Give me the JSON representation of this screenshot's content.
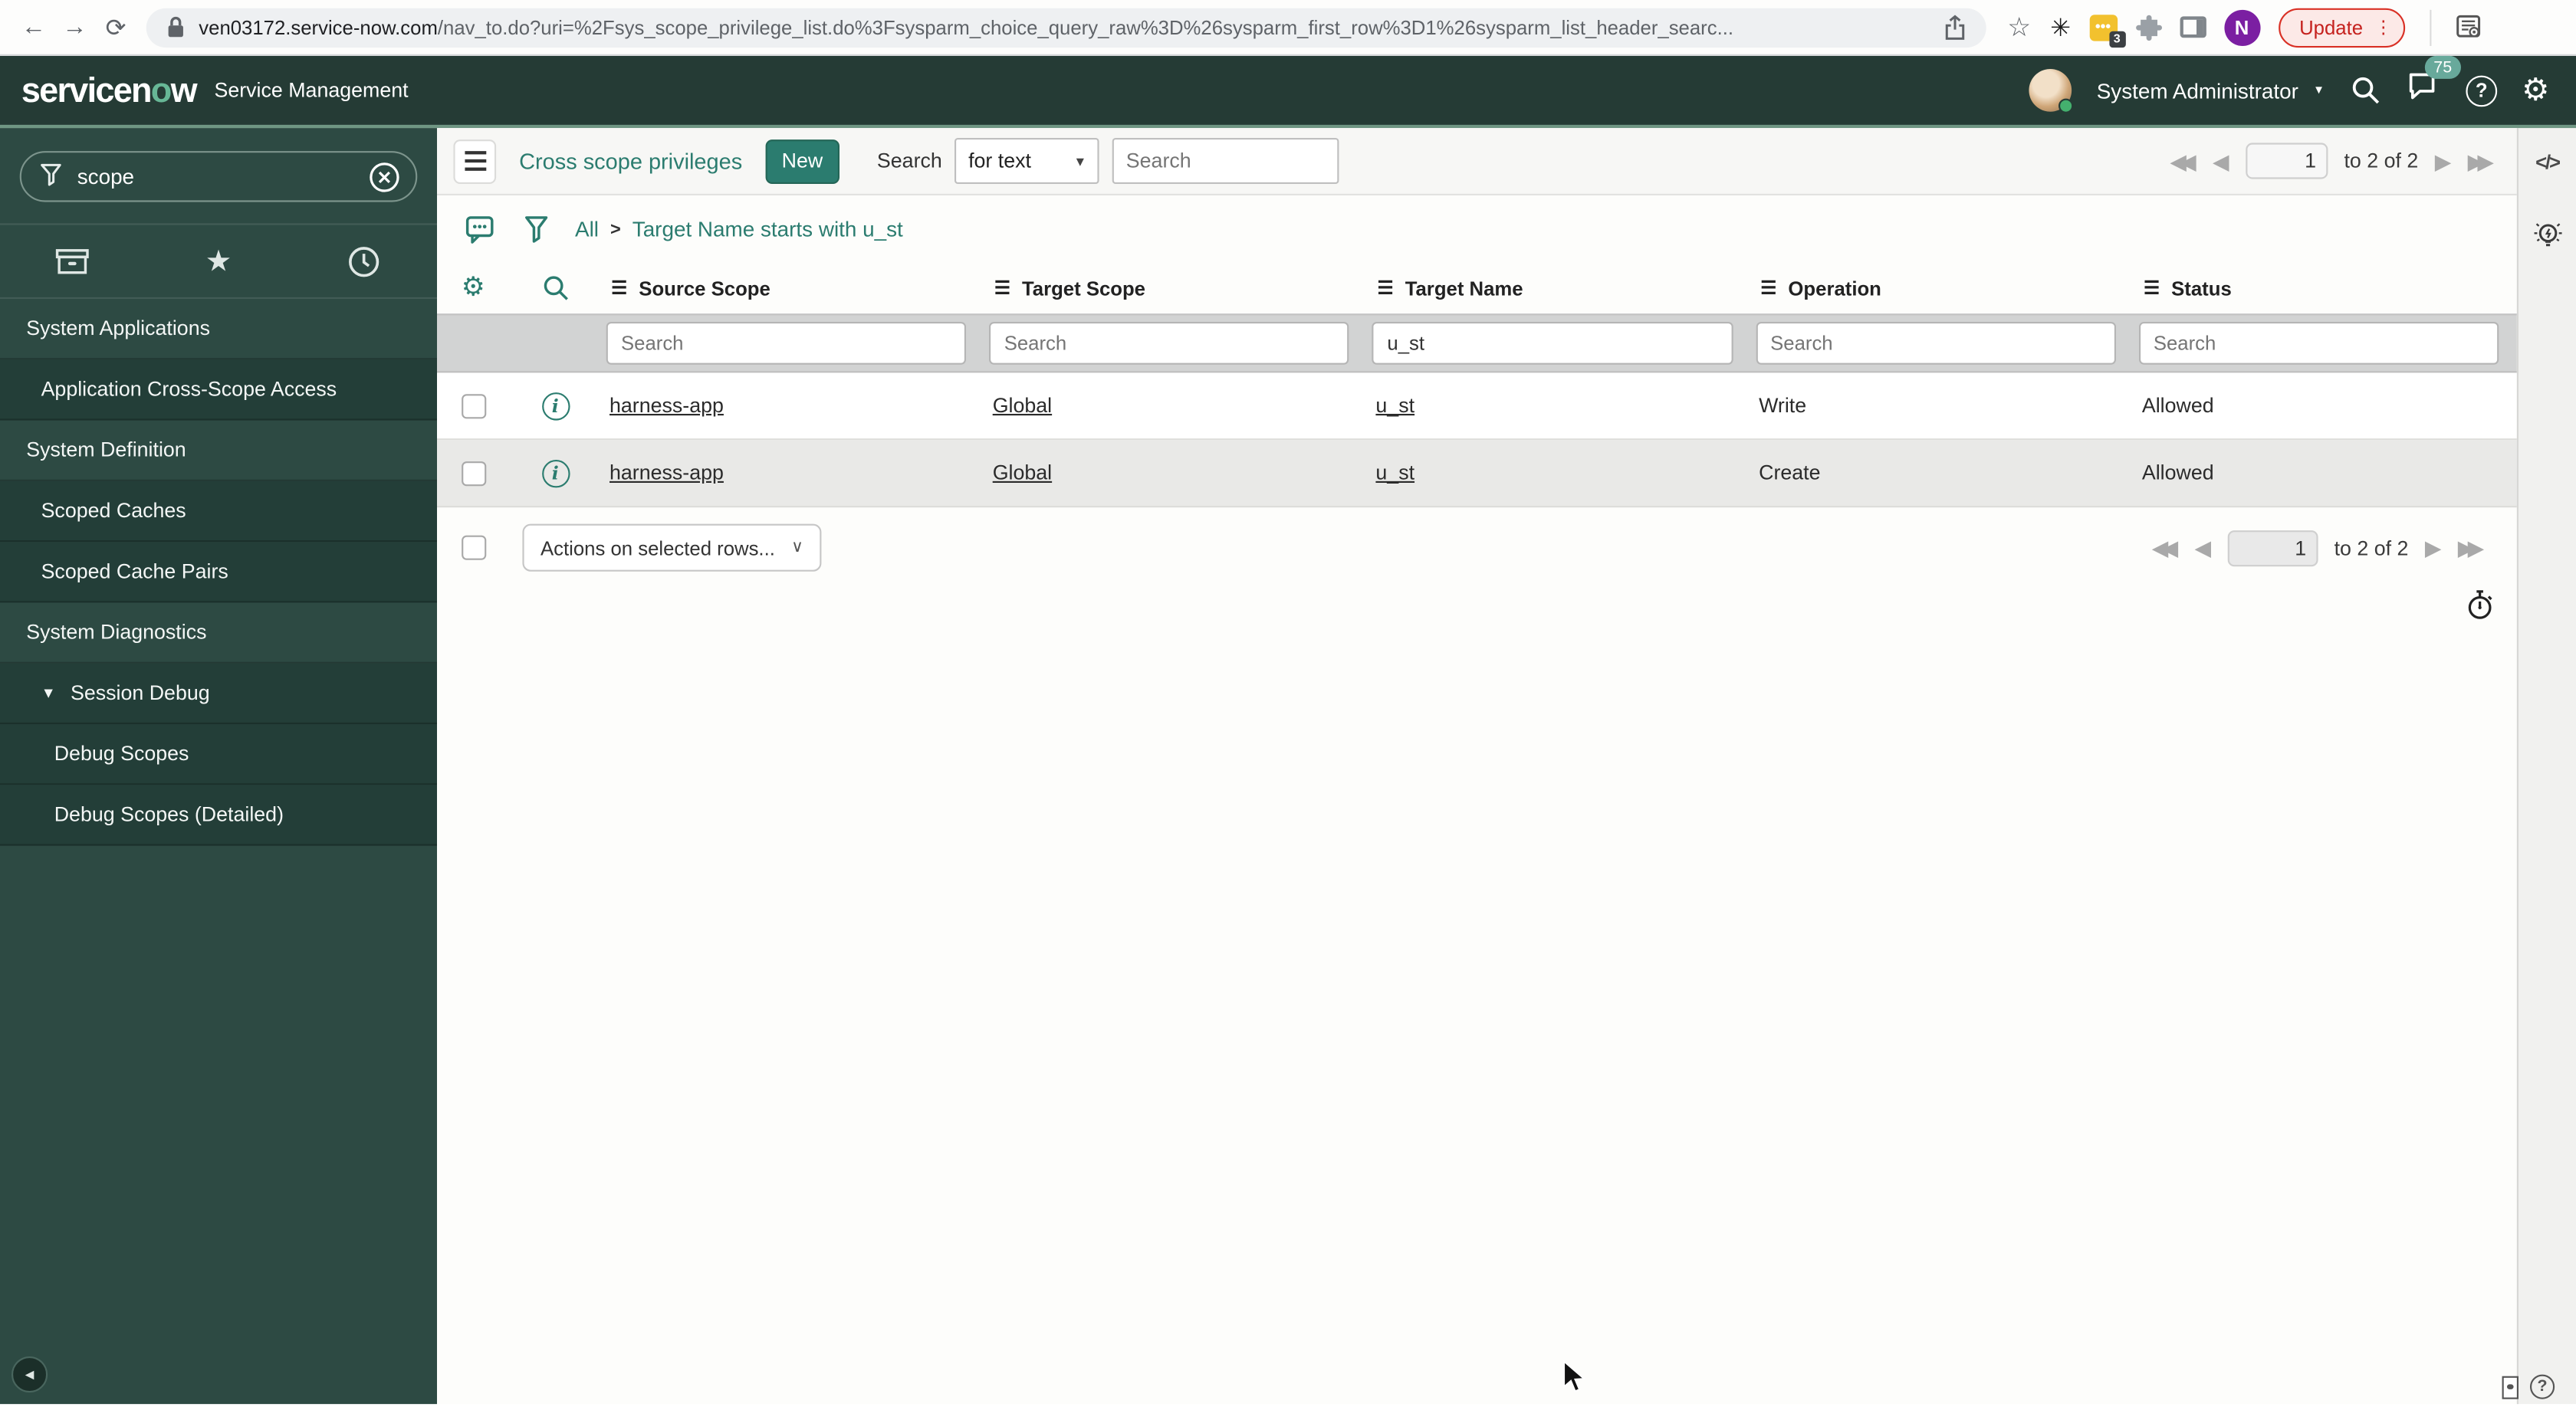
{
  "browser": {
    "url_domain": "ven03172.service-now.com",
    "url_path": "/nav_to.do?uri=%2Fsys_scope_privilege_list.do%3Fsysparm_choice_query_raw%3D%26sysparm_first_row%3D1%26sysparm_list_header_searc...",
    "update_label": "Update",
    "update_dots": "⋮",
    "profile_initial": "N",
    "extension_badge": "3",
    "extension_dots": "•••",
    "icons": {
      "back": "←",
      "forward": "→",
      "reload": "⟳",
      "bookmark": "☆",
      "spinner": "✳"
    }
  },
  "banner": {
    "logo_prefix": "servicen",
    "logo_o": "o",
    "logo_suffix": "w",
    "product": "Service Management",
    "user_name": "System Administrator",
    "user_caret": "▼",
    "notification_count": "75",
    "help_glyph": "?",
    "gear_glyph": "⚙"
  },
  "sidebar": {
    "search_value": "scope",
    "favorites_glyph": "★",
    "collapse_glyph": "◄",
    "items": [
      {
        "label": "System Applications",
        "type": "section"
      },
      {
        "label": "Application Cross-Scope Access",
        "type": "child"
      },
      {
        "label": "System Definition",
        "type": "section"
      },
      {
        "label": "Scoped Caches",
        "type": "child"
      },
      {
        "label": "Scoped Cache Pairs",
        "type": "child"
      },
      {
        "label": "System Diagnostics",
        "type": "section"
      },
      {
        "label": "Session Debug",
        "type": "child",
        "caret": "▼"
      },
      {
        "label": "Debug Scopes",
        "type": "grandchild"
      },
      {
        "label": "Debug Scopes (Detailed)",
        "type": "grandchild"
      }
    ]
  },
  "list": {
    "title": "Cross scope privileges",
    "new_button": "New",
    "search_label": "Search",
    "search_type": "for text",
    "select_caret": "▼",
    "search_placeholder": "Search",
    "menu_glyph": "☰"
  },
  "breadcrumb": {
    "root": "All",
    "separator": ">",
    "query": "Target Name starts with u_st"
  },
  "pagination": {
    "page": "1",
    "range_label": "to 2 of 2",
    "first": "◀◀",
    "prev": "◀",
    "next": "▶",
    "last": "▶▶"
  },
  "table": {
    "columns": [
      "Source Scope",
      "Target Scope",
      "Target Name",
      "Operation",
      "Status"
    ],
    "filters": [
      {
        "placeholder": "Search",
        "value": ""
      },
      {
        "placeholder": "Search",
        "value": ""
      },
      {
        "placeholder": "Search",
        "value": "u_st"
      },
      {
        "placeholder": "Search",
        "value": ""
      },
      {
        "placeholder": "Search",
        "value": ""
      }
    ],
    "rows": [
      {
        "info": "i",
        "source_scope": "harness-app",
        "target_scope": "Global",
        "target_name": "u_st",
        "operation": "Write",
        "status": "Allowed"
      },
      {
        "info": "i",
        "source_scope": "harness-app",
        "target_scope": "Global",
        "target_name": "u_st",
        "operation": "Create",
        "status": "Allowed"
      }
    ]
  },
  "footer": {
    "actions_label": "Actions on selected rows...",
    "chevron": "∨"
  },
  "right_rail": {
    "code_glyph": "</>",
    "help_glyph": "?"
  },
  "colors": {
    "accent": "#2b7c6f",
    "banner_bg": "#253b35",
    "sidebar_bg": "#2d4a43",
    "selected_row_bg": "#e9e9e7",
    "update_red": "#d93025"
  }
}
